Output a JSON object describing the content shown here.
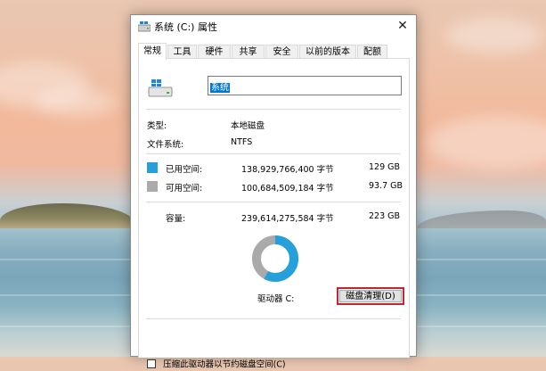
{
  "window": {
    "title": "系统 (C:) 属性",
    "close_glyph": "✕"
  },
  "tabs": [
    {
      "label": "常规",
      "active": true
    },
    {
      "label": "工具"
    },
    {
      "label": "硬件"
    },
    {
      "label": "共享"
    },
    {
      "label": "安全"
    },
    {
      "label": "以前的版本"
    },
    {
      "label": "配额"
    }
  ],
  "general": {
    "drive_name": "系统",
    "type_label": "类型:",
    "type_value": "本地磁盘",
    "fs_label": "文件系统:",
    "fs_value": "NTFS",
    "used": {
      "label": "已用空间:",
      "bytes": "138,929,766,400 字节",
      "size": "129 GB",
      "color": "#26a0da"
    },
    "free": {
      "label": "可用空间:",
      "bytes": "100,684,509,184 字节",
      "size": "93.7 GB",
      "color": "#aaaaaa"
    },
    "capacity": {
      "label": "容量:",
      "bytes": "239,614,275,584 字节",
      "size": "223 GB"
    },
    "drive_letter_label": "驱动器 C:",
    "cleanup_button": "磁盘清理(D)",
    "compress_checkbox": "压缩此驱动器以节约磁盘空间(C)",
    "used_fraction": 0.58
  },
  "icons": {
    "title": "drive-icon",
    "drive": "windows-drive-icon",
    "close": "close-icon"
  }
}
